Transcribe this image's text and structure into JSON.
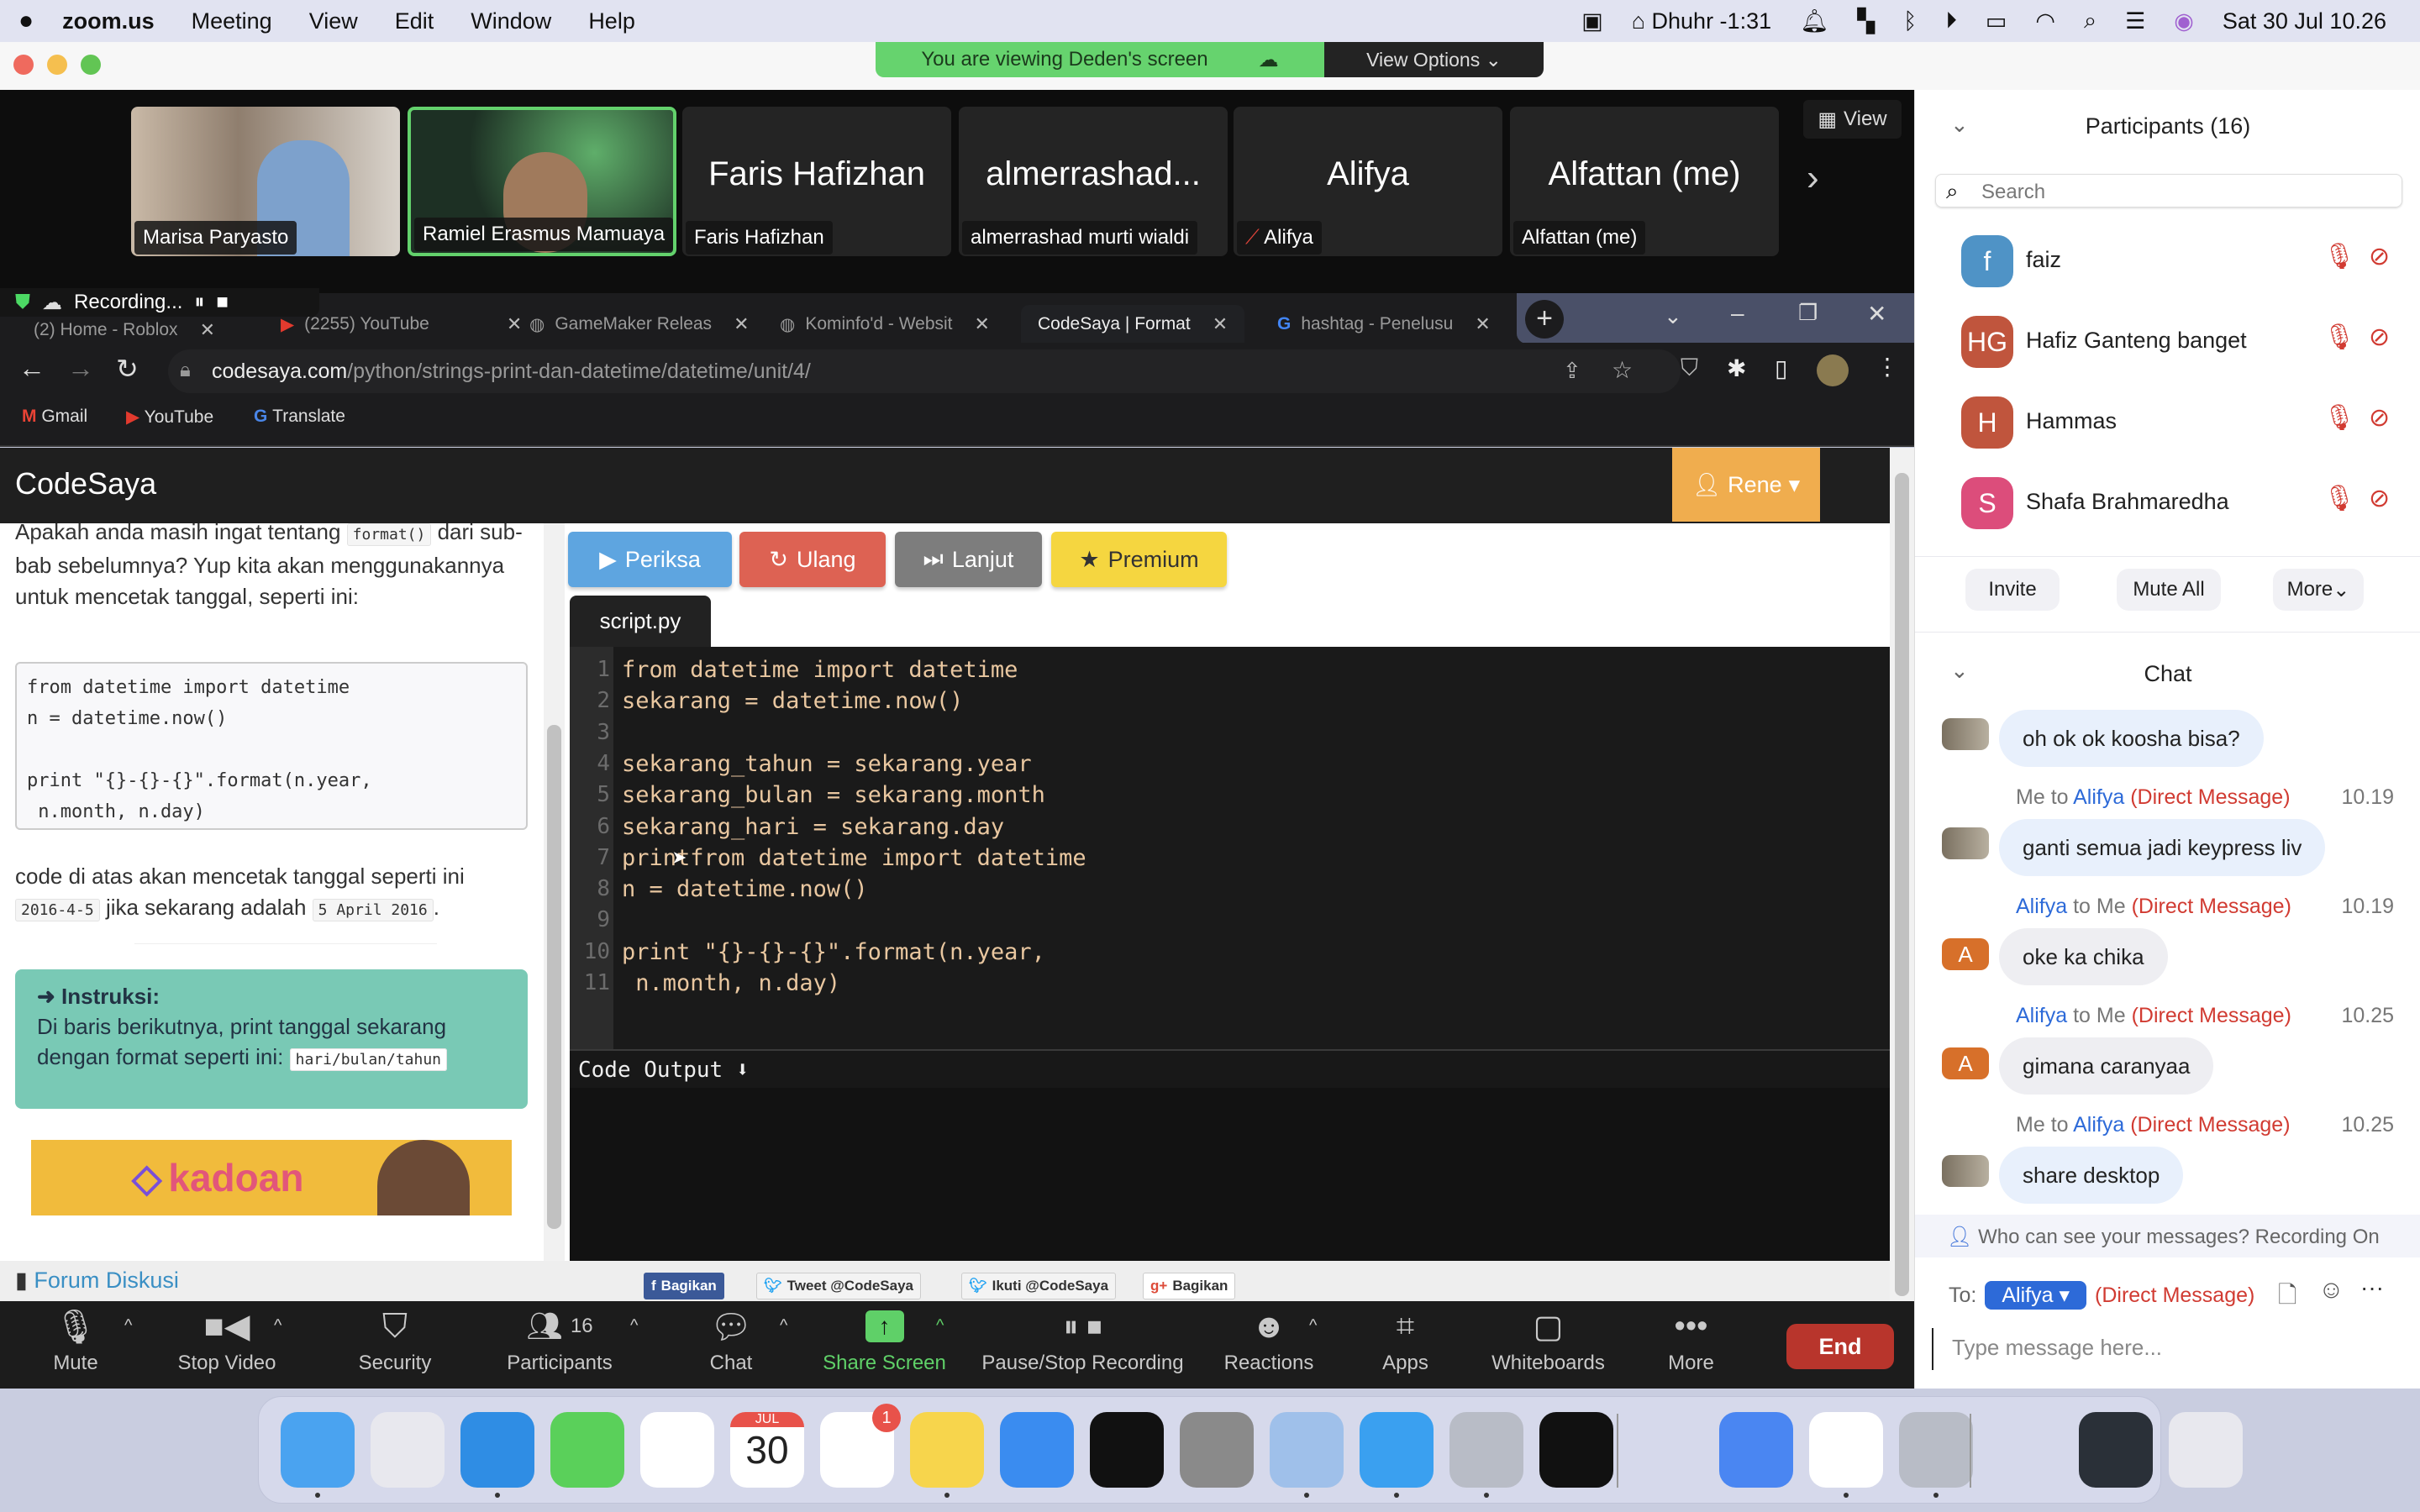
{
  "menubar": {
    "app_name": "zoom.us",
    "items": [
      "Meeting",
      "View",
      "Edit",
      "Window",
      "Help"
    ],
    "prayer": "Dhuhr -1:31",
    "datetime": "Sat 30 Jul  10.26"
  },
  "zoom": {
    "banner": "You are viewing Deden's screen",
    "view_options": "View Options ⌄",
    "view_button": "View",
    "tiles": [
      {
        "big": "",
        "name": "Marisa Paryasto",
        "video": true
      },
      {
        "big": "",
        "name": "Ramiel Erasmus Mamuaya",
        "video": true,
        "active": true
      },
      {
        "big": "Faris Hafizhan",
        "name": "Faris Hafizhan"
      },
      {
        "big": "almerrashad...",
        "name": "almerrashad murti wialdi"
      },
      {
        "big": "Alifya",
        "name": "Alifya",
        "muted": true
      },
      {
        "big": "Alfattan (me)",
        "name": "Alfattan (me)"
      }
    ],
    "recording": "Recording..."
  },
  "browser": {
    "tabs": [
      "(2) Home - Roblox",
      "(2255) YouTube",
      "GameMaker Releas",
      "Kominfo'd - Websit",
      "CodeSaya | Format",
      "hashtag - Penelusu"
    ],
    "url_host": "codesaya.com",
    "url_path": "/python/strings-print-dan-datetime/datetime/unit/4/",
    "bookmarks": [
      "Gmail",
      "YouTube",
      "Translate"
    ]
  },
  "codesaya": {
    "brand": "CodeSaya",
    "user": "Rene",
    "lesson": {
      "p1_a": "Apakah anda masih ingat tentang",
      "p1_code": "format()",
      "p1_b": "dari sub-bab sebelumnya? Yup kita akan menggunakannya untuk mencetak tanggal, seperti ini:",
      "example": [
        "from datetime import datetime",
        "n = datetime.now()",
        "",
        "print \"{}-{}-{}\".format(n.year,",
        " n.month, n.day)"
      ],
      "p2_a": "code di atas akan mencetak tanggal seperti ini",
      "p2_code1": "2016-4-5",
      "p2_b": "jika sekarang adalah",
      "p2_code2": "5 April 2016",
      "instr_title": "➜ Instruksi:",
      "instr_text": "Di baris berikutnya, print tanggal sekarang dengan format seperti ini:",
      "instr_code": "hari/bulan/tahun",
      "ad": "kadoan"
    },
    "buttons": {
      "check": "Periksa",
      "reset": "Ulang",
      "next": "Lanjut",
      "premium": "Premium"
    },
    "file_tab": "script.py",
    "editor_lines": [
      "from datetime import datetime",
      "sekarang = datetime.now()",
      "",
      "sekarang_tahun = sekarang.year",
      "sekarang_bulan = sekarang.month",
      "sekarang_hari = sekarang.day",
      "printfrom datetime import datetime",
      "n = datetime.now()",
      "",
      "print \"{}-{}-{}\".format(n.year,",
      " n.month, n.day)"
    ],
    "output_label": "Code Output ⬇",
    "forum": "Forum Diskusi",
    "share": [
      "Bagikan",
      "Tweet @CodeSaya",
      "Ikuti @CodeSaya",
      "Bagikan"
    ]
  },
  "toolbar": {
    "items": [
      "Mute",
      "Stop Video",
      "Security",
      "Participants",
      "Chat",
      "Share Screen",
      "Pause/Stop Recording",
      "Reactions",
      "Apps",
      "Whiteboards",
      "More"
    ],
    "participant_count": "16",
    "end": "End"
  },
  "participants": {
    "title": "Participants (16)",
    "search_placeholder": "Search",
    "list": [
      {
        "initials": "f",
        "name": "faiz",
        "color": "#4f93c6"
      },
      {
        "initials": "HG",
        "name": "Hafiz Ganteng banget",
        "color": "#c0553d"
      },
      {
        "initials": "H",
        "name": "Hammas",
        "color": "#c0553d"
      },
      {
        "initials": "S",
        "name": "Shafa Brahmaredha",
        "color": "#dc4d7b"
      }
    ],
    "invite": "Invite",
    "mute_all": "Mute All",
    "more": "More"
  },
  "chat": {
    "title": "Chat",
    "messages": [
      {
        "text": "oh ok ok koosha bisa?",
        "mine": true
      },
      {
        "from": "Me",
        "to_word": "to",
        "to": "Alifya",
        "dm": "(Direct Message)",
        "time": "10.19",
        "text": "ganti semua jadi keypress liv",
        "mine": true
      },
      {
        "from": "Alifya",
        "to_word": "to",
        "to": "Me",
        "dm": "(Direct Message)",
        "time": "10.19",
        "text": "oke ka chika",
        "avatar": "A"
      },
      {
        "from": "Alifya",
        "to_word": "to",
        "to": "Me",
        "dm": "(Direct Message)",
        "time": "10.25",
        "text": "gimana caranyaa",
        "avatar": "A"
      },
      {
        "from": "Me",
        "to_word": "to",
        "to": "Alifya",
        "dm": "(Direct Message)",
        "time": "10.25",
        "text": "share desktop",
        "mine": true
      }
    ],
    "privacy": "Who can see your messages? Recording On",
    "to_label": "To:",
    "recipient": "Alifya",
    "recipient_dm": "(Direct Message)",
    "input_placeholder": "Type message here..."
  },
  "dock": {
    "apps": [
      "Finder",
      "Launchpad",
      "Safari",
      "Messages",
      "Photos",
      "Calendar",
      "Reminders",
      "Notes",
      "Keynote",
      "Terminal",
      "System Preferences",
      "Preview",
      "Roblox Studio",
      "Roblox",
      "Activity Monitor",
      "Zoom",
      "Chrome",
      "Roblox Player",
      "Downloads",
      "Trash"
    ],
    "calendar_month": "JUL",
    "calendar_day": "30",
    "reminders_badge": "1"
  },
  "colors": {
    "accent_green": "#66d36e",
    "end_red": "#b8352c",
    "dm_red": "#d13b32",
    "link_blue": "#2d6ad8",
    "instr_teal": "#79c9b5"
  }
}
